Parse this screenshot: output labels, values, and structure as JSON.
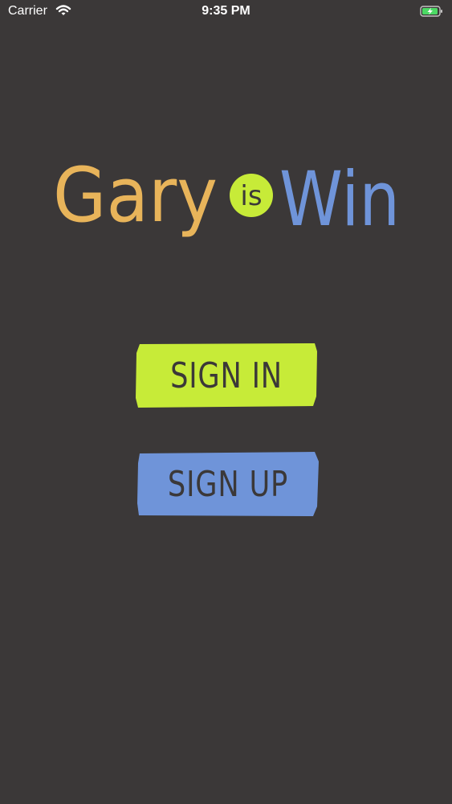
{
  "status_bar": {
    "carrier": "Carrier",
    "time": "9:35 PM",
    "wifi_icon": "wifi-icon",
    "battery_icon": "battery-charging-icon"
  },
  "logo": {
    "word1": "Gary",
    "word2": "is",
    "word3": "Win",
    "colors": {
      "gary": "#e8b45a",
      "is_badge": "#c7eb38",
      "win": "#6f94d9"
    }
  },
  "buttons": {
    "sign_in": {
      "label": "SIGN IN",
      "color": "#c7eb38"
    },
    "sign_up": {
      "label": "SIGN UP",
      "color": "#6f94d9"
    }
  },
  "colors": {
    "background": "#3b3838",
    "button_text": "#3b3838"
  }
}
